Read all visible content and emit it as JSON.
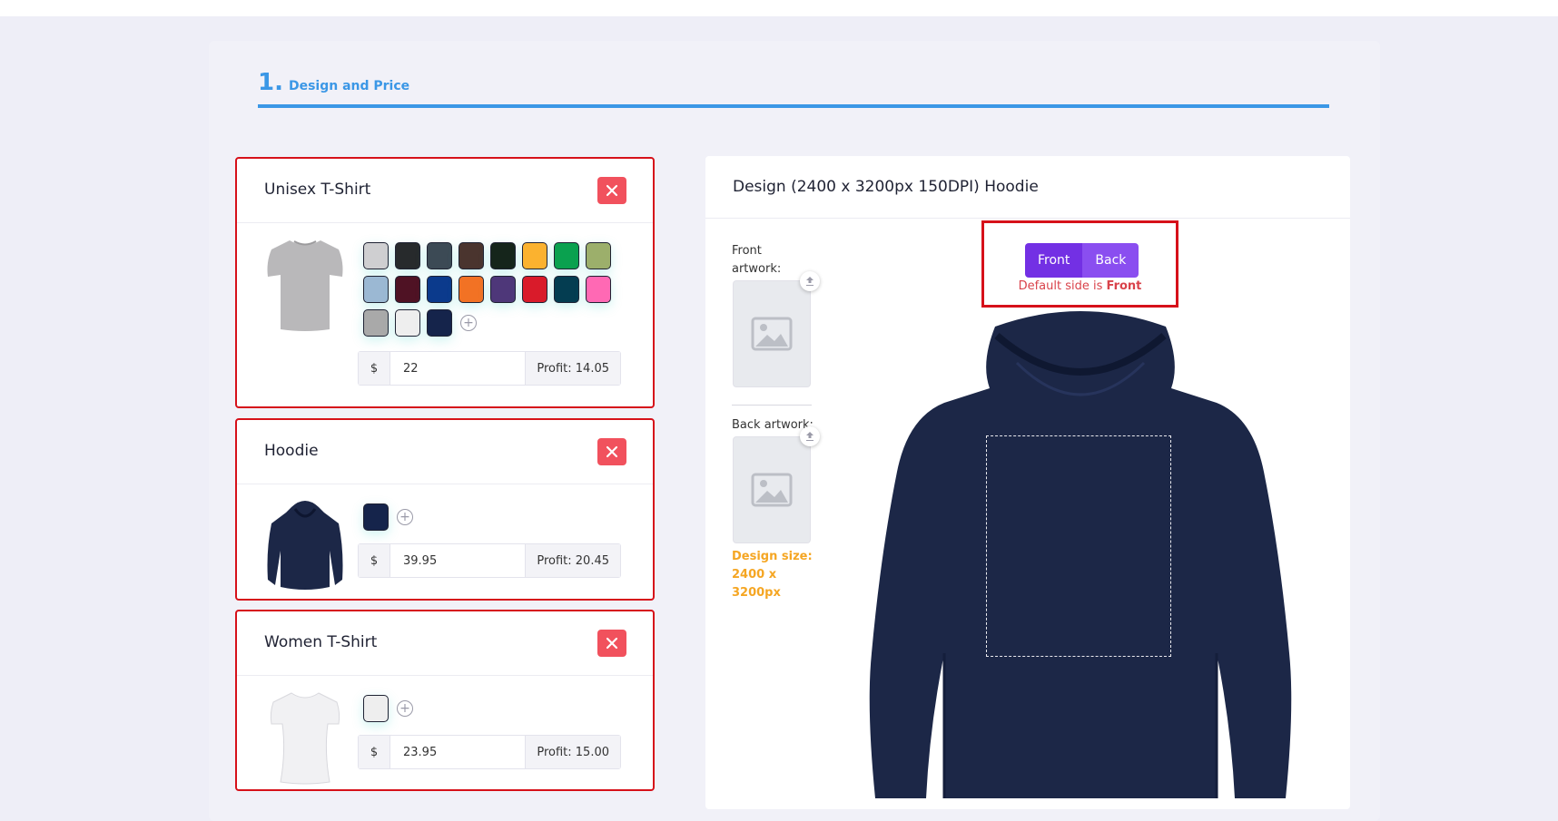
{
  "step": {
    "number": "1.",
    "title": "Design and Price"
  },
  "products": [
    {
      "name": "Unisex T-Shirt",
      "thumb_icon": "tshirt-gray-icon",
      "colors": [
        "#cfcfd1",
        "#272a2c",
        "#3c4a55",
        "#4a342e",
        "#15251b",
        "#fbb22f",
        "#0aa14f",
        "#9caf6b",
        "#9bb8d3",
        "#4f1224",
        "#0b3a8c",
        "#f27224",
        "#4e3779",
        "#d91b2a",
        "#043d51",
        "#ff69b4",
        "#a9a9a9",
        "#eeeeee",
        "#15244b"
      ],
      "currency": "$",
      "price": "22",
      "profit": "Profit: 14.05"
    },
    {
      "name": "Hoodie",
      "thumb_icon": "hoodie-navy-icon",
      "colors": [
        "#15244b"
      ],
      "currency": "$",
      "price": "39.95",
      "profit": "Profit: 20.45"
    },
    {
      "name": "Women T-Shirt",
      "thumb_icon": "tshirt-white-icon",
      "colors": [
        "#eeeeee"
      ],
      "currency": "$",
      "price": "23.95",
      "profit": "Profit: 15.00"
    }
  ],
  "design": {
    "title": "Design (2400 x 3200px 150DPI) Hoodie",
    "front_label": "Front artwork:",
    "back_label": "Back artwork:",
    "size_note": "Design size: 2400 x 3200px",
    "side_buttons": {
      "front": "Front",
      "back": "Back"
    },
    "default_prefix": "Default side is",
    "default_value": "Front",
    "mockup_color": "#1c2747"
  },
  "colors": {
    "accent": "#3b97e6",
    "danger": "#f1515d",
    "outline": "#d6111a",
    "purple": "#7330e4",
    "warning": "#f5a623"
  }
}
